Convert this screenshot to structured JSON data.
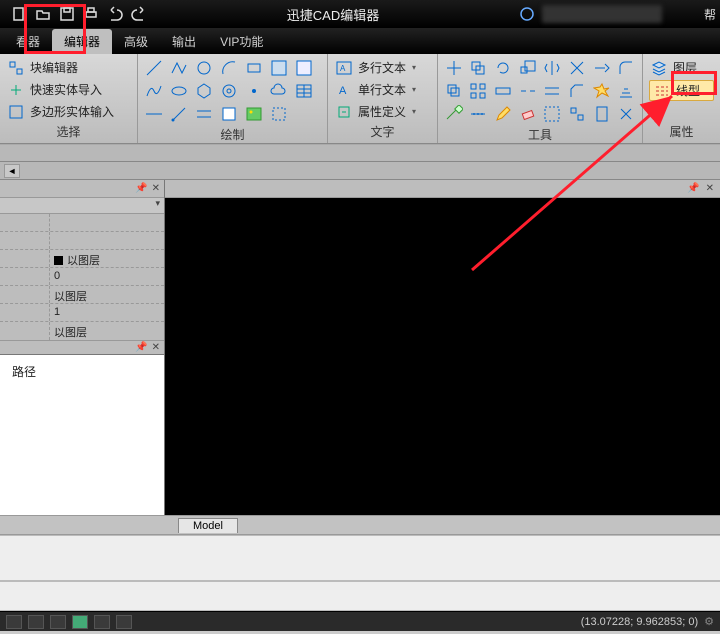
{
  "title": "迅捷CAD编辑器",
  "menus": {
    "m0": "看器",
    "m1": "编辑器",
    "m2": "高级",
    "m3": "输出",
    "m4": "VIP功能",
    "help": "帮"
  },
  "qat": {
    "new": "new-file-icon",
    "open": "open-icon",
    "save": "save-icon",
    "print": "print-icon",
    "undo": "undo-icon",
    "redo": "redo-icon"
  },
  "ribbon": {
    "select": {
      "label": "选择",
      "items": {
        "blockeditor": "块编辑器",
        "quickimport": "快速实体导入",
        "polyimport": "多边形实体输入"
      }
    },
    "draw": {
      "label": "绘制"
    },
    "text": {
      "label": "文字",
      "items": {
        "mtext": "多行文本",
        "stext": "单行文本",
        "attrdef": "属性定义"
      }
    },
    "tools": {
      "label": "工具"
    },
    "props": {
      "label": "属性",
      "items": {
        "layer": "图层",
        "linetype": "线型"
      }
    }
  },
  "propgrid": {
    "r1": "以图层",
    "r2": "0",
    "r3": "以图层",
    "r4": "1",
    "r5": "以图层"
  },
  "path": {
    "label": "路径"
  },
  "model_tab": "Model",
  "status": {
    "coords": "(13.07228; 9.962853; 0)"
  }
}
